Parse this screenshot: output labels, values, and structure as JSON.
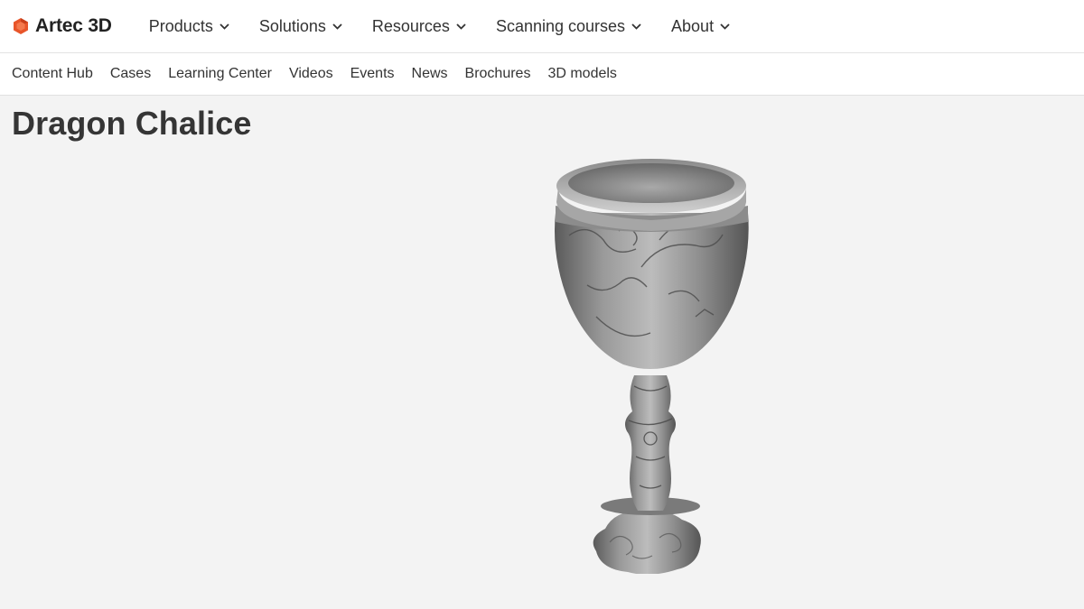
{
  "brand": {
    "name": "Artec 3D",
    "logo_icon": "artec-hexagon-logo-icon",
    "accent": "#e8552a"
  },
  "main_nav": [
    {
      "label": "Products"
    },
    {
      "label": "Solutions"
    },
    {
      "label": "Resources"
    },
    {
      "label": "Scanning courses"
    },
    {
      "label": "About"
    }
  ],
  "sub_nav": [
    {
      "label": "Content Hub"
    },
    {
      "label": "Cases"
    },
    {
      "label": "Learning Center"
    },
    {
      "label": "Videos"
    },
    {
      "label": "Events"
    },
    {
      "label": "News"
    },
    {
      "label": "Brochures"
    },
    {
      "label": "3D models"
    }
  ],
  "page": {
    "title": "Dragon Chalice"
  }
}
